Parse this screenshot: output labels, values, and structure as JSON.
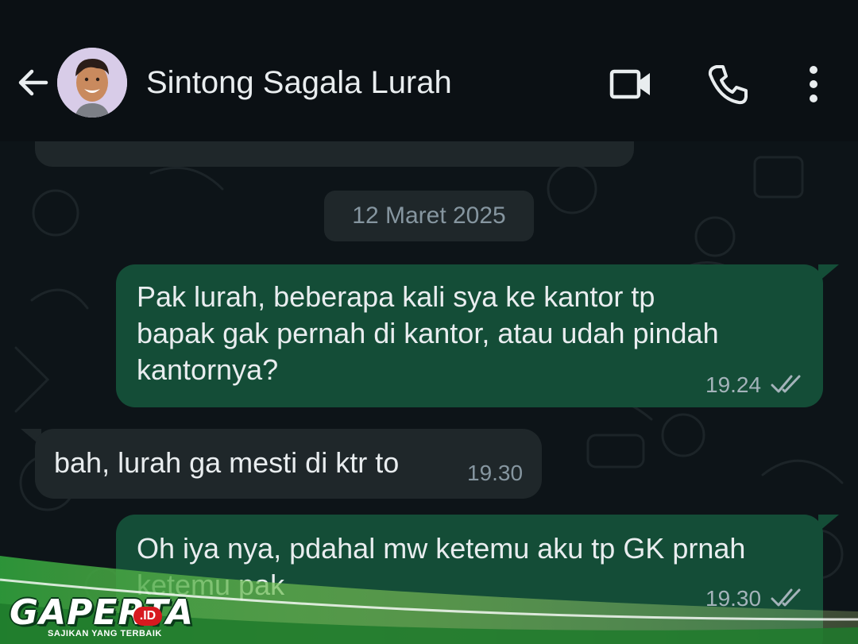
{
  "header": {
    "contact_name": "Sintong Sagala Lurah",
    "back_icon": "arrow-left-icon",
    "video_icon": "video-call-icon",
    "phone_icon": "phone-icon",
    "more_icon": "more-vertical-icon"
  },
  "chat": {
    "date_label": "12 Maret 2025",
    "messages": [
      {
        "direction": "outgoing",
        "lines": [
          "Pak lurah, beberapa kali sya ke kantor tp",
          "bapak gak pernah di kantor, atau udah pindah",
          "kantornya?"
        ],
        "time": "19.24",
        "status": "delivered"
      },
      {
        "direction": "incoming",
        "lines": [
          "bah, lurah ga mesti di ktr to"
        ],
        "time": "19.30"
      },
      {
        "direction": "outgoing",
        "lines": [
          "Oh iya nya, pdahal mw ketemu aku tp GK prnah",
          "ketemu pak"
        ],
        "time": "19.30",
        "status": "delivered"
      }
    ]
  },
  "watermark": {
    "logo": "GAPERTA",
    "suffix": ".ID",
    "tagline": "SAJIKAN YANG TERBAIK"
  },
  "colors": {
    "outgoing_bubble": "#144d37",
    "incoming_bubble": "#1f272a",
    "background": "#0b1014",
    "text": "#e9edef",
    "meta": "#8696a0"
  }
}
